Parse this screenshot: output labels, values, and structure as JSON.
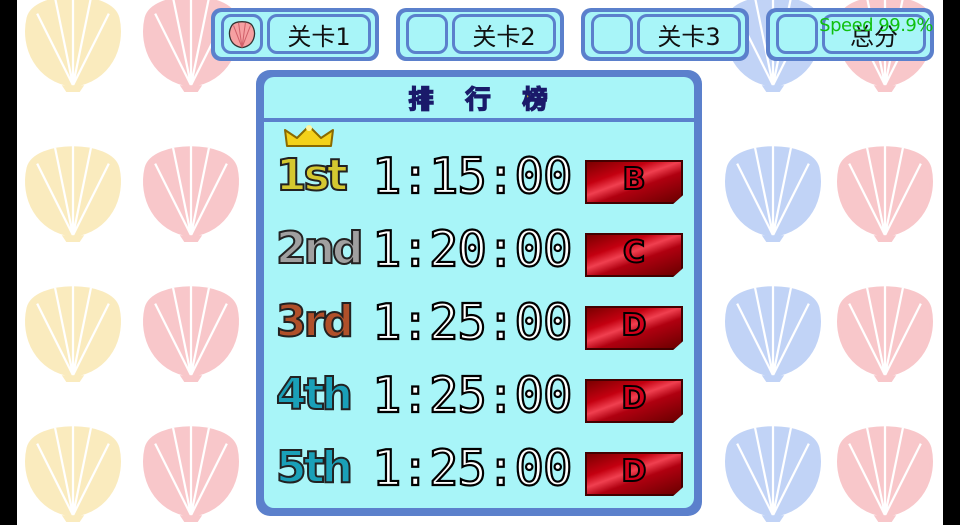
{
  "tabs": [
    {
      "label": "关卡1",
      "has_shell_icon": true
    },
    {
      "label": "关卡2",
      "has_shell_icon": false
    },
    {
      "label": "关卡3",
      "has_shell_icon": false
    },
    {
      "label": "总分",
      "has_shell_icon": false
    }
  ],
  "speed_text": "Speed 99.9%",
  "leaderboard": {
    "title_chars": [
      "排",
      "行",
      "榜"
    ],
    "rows": [
      {
        "rank": "1st",
        "time": "1:15:00",
        "grade": "B",
        "rank_color": "#d4c830"
      },
      {
        "rank": "2nd",
        "time": "1:20:00",
        "grade": "C",
        "rank_color": "#a0a0a0"
      },
      {
        "rank": "3rd",
        "time": "1:25:00",
        "grade": "D",
        "rank_color": "#b0502a"
      },
      {
        "rank": "4th",
        "time": "1:25:00",
        "grade": "D",
        "rank_color": "#1aa0b8"
      },
      {
        "rank": "5th",
        "time": "1:25:00",
        "grade": "D",
        "rank_color": "#1aa0b8"
      }
    ]
  },
  "colors": {
    "frame": "#5b80cc",
    "panel_fill": "#a8f5f8",
    "speed_text": "#10c010",
    "shell_yellow": "#f7dc8a",
    "shell_pink": "#f39aa0",
    "shell_blue": "#8fb0f0"
  }
}
